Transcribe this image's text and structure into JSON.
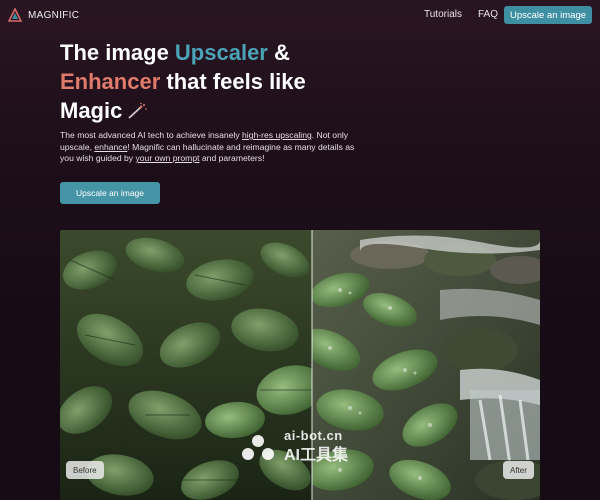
{
  "nav": {
    "brand": "MAGNIFIC",
    "links": [
      "Tutorials",
      "FAQ"
    ],
    "cta": "Upscale an image"
  },
  "hero": {
    "title_part1": "The image ",
    "title_accent1": "Upscaler",
    "title_part2": " &",
    "title_accent2": "Enhancer",
    "title_part3": " that feels like",
    "title_part4": "Magic",
    "desc_1": "The most advanced AI tech to achieve insanely ",
    "desc_link1": "high-res upscaling",
    "desc_2": ". Not only upscale, ",
    "desc_link2": "enhance",
    "desc_3": "! Magnific can hallucinate and reimagine as many details as you wish guided by ",
    "desc_link3": "your own prompt",
    "desc_4": " and parameters!",
    "cta": "Upscale an image"
  },
  "comparison": {
    "before_label": "Before",
    "after_label": "After"
  },
  "watermark": {
    "line1": "ai-bot.cn",
    "line2": "AI工具集"
  },
  "colors": {
    "accent_blue": "#4aa3b6",
    "accent_red": "#e07a6a",
    "button": "#4595a7"
  }
}
